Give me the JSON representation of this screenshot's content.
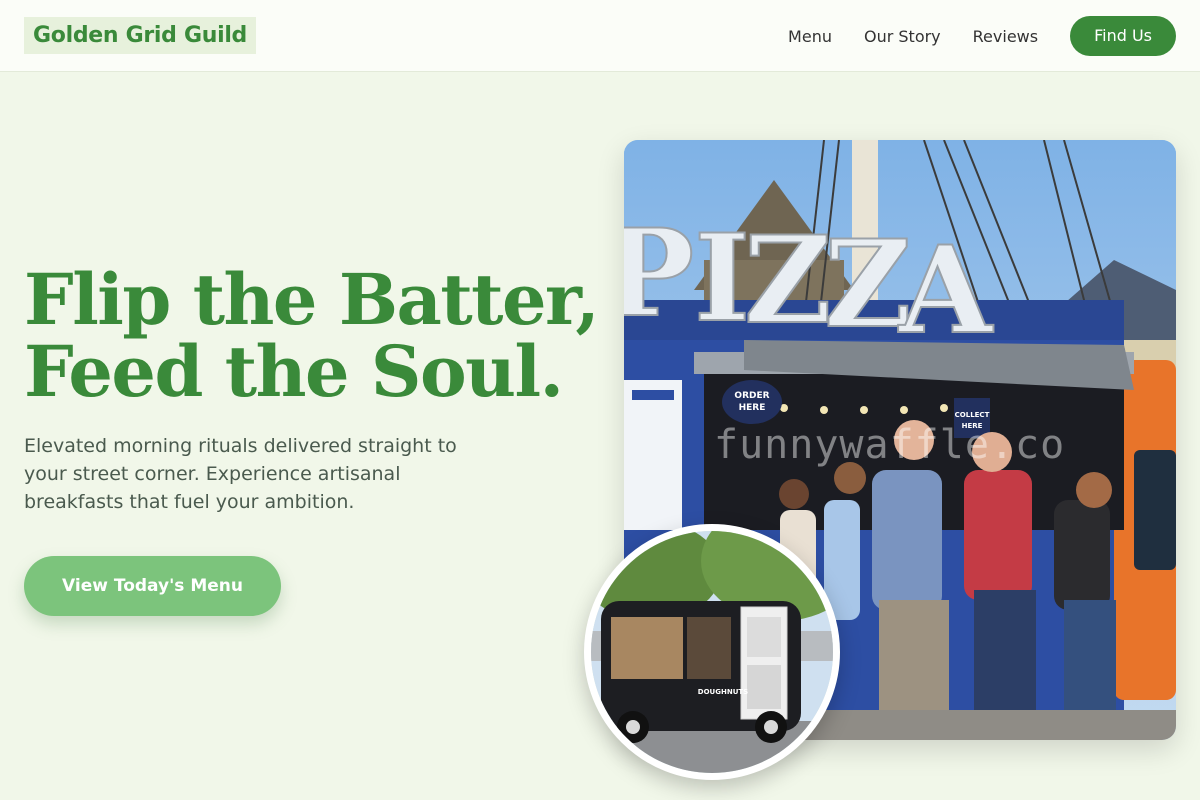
{
  "header": {
    "logo": "Golden Grid Guild",
    "nav": [
      "Menu",
      "Our Story",
      "Reviews"
    ],
    "cta": "Find Us"
  },
  "hero": {
    "title_line1": "Flip the Batter,",
    "title_line2": "Feed the Soul.",
    "subtitle": "Elevated morning rituals delivered straight to your street corner. Experience artisanal breakfasts that fuel your ambition.",
    "button": "View Today's Menu"
  },
  "images": {
    "main_watermark": "funnywaffle.co",
    "main_sign_order": "ORDER HERE",
    "main_sign_collect": "COLLECT HERE",
    "main_sign_pizza": "PIZZA",
    "inset_truck_text": "DOUGHNUTS"
  },
  "colors": {
    "brand_green": "#3a8a3a",
    "button_light_green": "#7cc47c",
    "background": "#f1f7e9",
    "header_bg": "#fbfdf8"
  }
}
